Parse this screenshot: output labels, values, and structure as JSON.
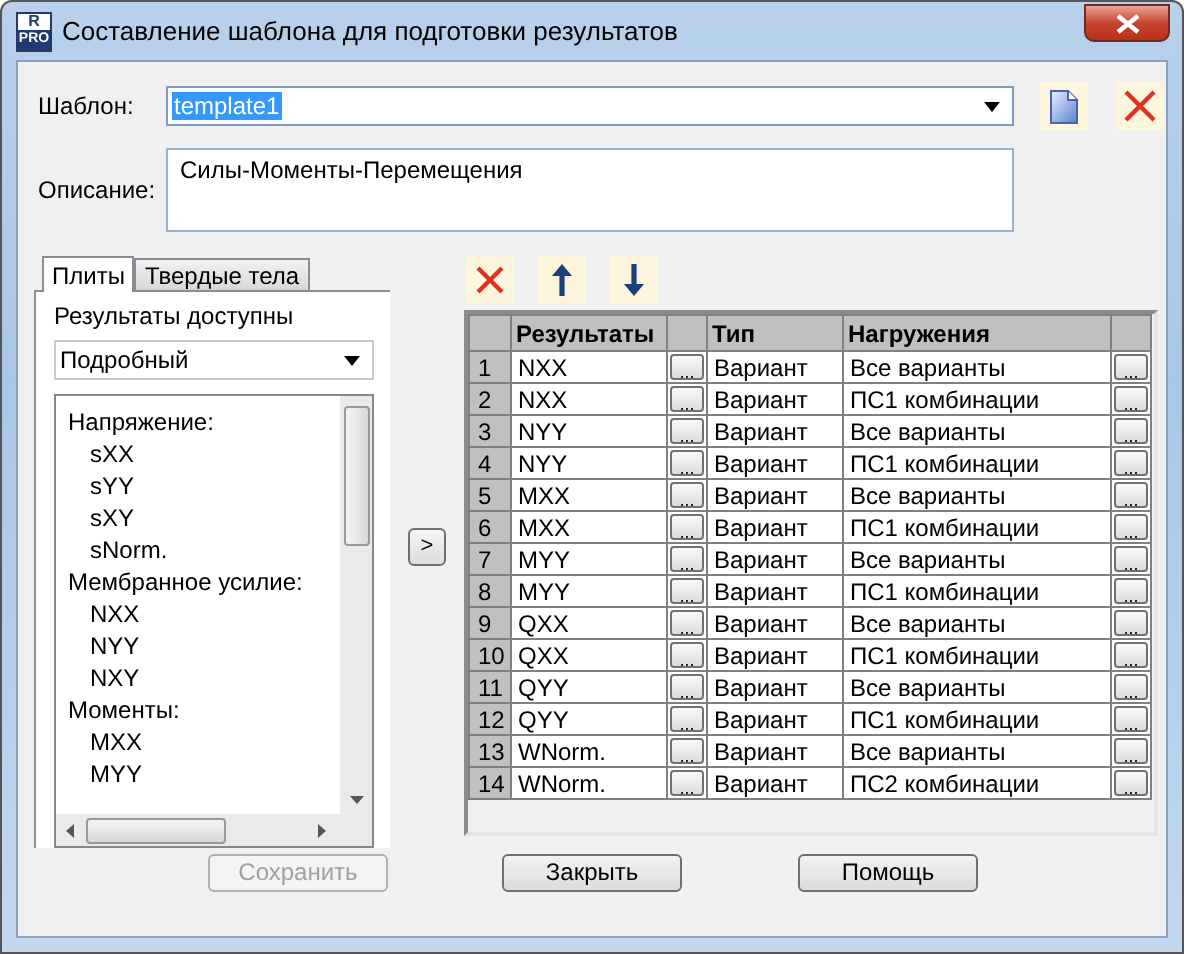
{
  "window": {
    "title": "Составление шаблона для подготовки результатов",
    "logo": [
      "R",
      "PRO"
    ]
  },
  "template": {
    "label": "Шаблон:",
    "value": "template1",
    "text_selected": true
  },
  "description": {
    "label": "Описание:",
    "value": "Силы-Моменты-Перемещения"
  },
  "tabs": [
    {
      "label": "Плиты",
      "selected": true
    },
    {
      "label": "Твердые тела",
      "selected": false
    }
  ],
  "available": {
    "label": "Результаты доступны",
    "mode": "Подробный",
    "tree": [
      {
        "label": "Напряжение:",
        "children": [
          {
            "label": "sXX"
          },
          {
            "label": "sYY"
          },
          {
            "label": "sXY"
          },
          {
            "label": "sNorm."
          }
        ]
      },
      {
        "label": "Мембранное усилие:",
        "children": [
          {
            "label": "NXX"
          },
          {
            "label": "NYY"
          },
          {
            "label": "NXY"
          }
        ]
      },
      {
        "label": "Моменты:",
        "children": [
          {
            "label": "MXX"
          },
          {
            "label": "MYY"
          }
        ]
      }
    ]
  },
  "add_button": ">",
  "grid": {
    "columns": [
      "Результаты",
      "Тип",
      "Нагружения"
    ],
    "rows": [
      {
        "number": "1",
        "result": "NXX",
        "result_button": "...",
        "type": "Вариант",
        "loads": "Все варианты",
        "loads_button": "..."
      },
      {
        "number": "2",
        "result": "NXX",
        "result_button": "...",
        "type": "Вариант",
        "loads": "ПС1 комбинации",
        "loads_button": "..."
      },
      {
        "number": "3",
        "result": "NYY",
        "result_button": "...",
        "type": "Вариант",
        "loads": "Все варианты",
        "loads_button": "..."
      },
      {
        "number": "4",
        "result": "NYY",
        "result_button": "...",
        "type": "Вариант",
        "loads": "ПС1 комбинации",
        "loads_button": "..."
      },
      {
        "number": "5",
        "result": "MXX",
        "result_button": "...",
        "type": "Вариант",
        "loads": "Все варианты",
        "loads_button": "..."
      },
      {
        "number": "6",
        "result": "MXX",
        "result_button": "...",
        "type": "Вариант",
        "loads": "ПС1 комбинации",
        "loads_button": "..."
      },
      {
        "number": "7",
        "result": "MYY",
        "result_button": "...",
        "type": "Вариант",
        "loads": "Все варианты",
        "loads_button": "..."
      },
      {
        "number": "8",
        "result": "MYY",
        "result_button": "...",
        "type": "Вариант",
        "loads": "ПС1 комбинации",
        "loads_button": "..."
      },
      {
        "number": "9",
        "result": "QXX",
        "result_button": "...",
        "type": "Вариант",
        "loads": "Все варианты",
        "loads_button": "..."
      },
      {
        "number": "10",
        "result": "QXX",
        "result_button": "...",
        "type": "Вариант",
        "loads": "ПС1 комбинации",
        "loads_button": "..."
      },
      {
        "number": "11",
        "result": "QYY",
        "result_button": "...",
        "type": "Вариант",
        "loads": "Все варианты",
        "loads_button": "..."
      },
      {
        "number": "12",
        "result": "QYY",
        "result_button": "...",
        "type": "Вариант",
        "loads": "ПС1 комбинации",
        "loads_button": "..."
      },
      {
        "number": "13",
        "result": "WNorm.",
        "result_button": "...",
        "type": "Вариант",
        "loads": "Все варианты",
        "loads_button": "..."
      },
      {
        "number": "14",
        "result": "WNorm.",
        "result_button": "...",
        "type": "Вариант",
        "loads": "ПС2 комбинации",
        "loads_button": "..."
      }
    ]
  },
  "buttons": [
    {
      "label": "Сохранить",
      "disabled": true
    },
    {
      "label": "Закрыть",
      "disabled": false
    },
    {
      "label": "Помощь",
      "disabled": false
    }
  ]
}
